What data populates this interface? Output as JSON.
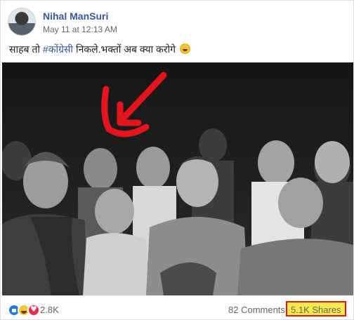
{
  "post": {
    "author": "Nihal ManSuri",
    "timestamp": "May 11 at 12:13 AM",
    "caption_before": "साहब तो ",
    "hashtag": "#कोंग्रेसी",
    "caption_after": " निकले.भक्तों अब क्या करोगे",
    "emoji": "rolling-on-floor-laughing-emoji"
  },
  "photo": {
    "description_icon": "group-photo",
    "annotation_color": "#e3141b"
  },
  "footer": {
    "reaction_icons": [
      "like-icon",
      "haha-icon",
      "love-icon"
    ],
    "reaction_count": "2.8K",
    "comments": "82 Comments",
    "shares": "5.1K Shares",
    "highlight_border": "#e3141b",
    "highlight_fill": "#f7e948"
  }
}
